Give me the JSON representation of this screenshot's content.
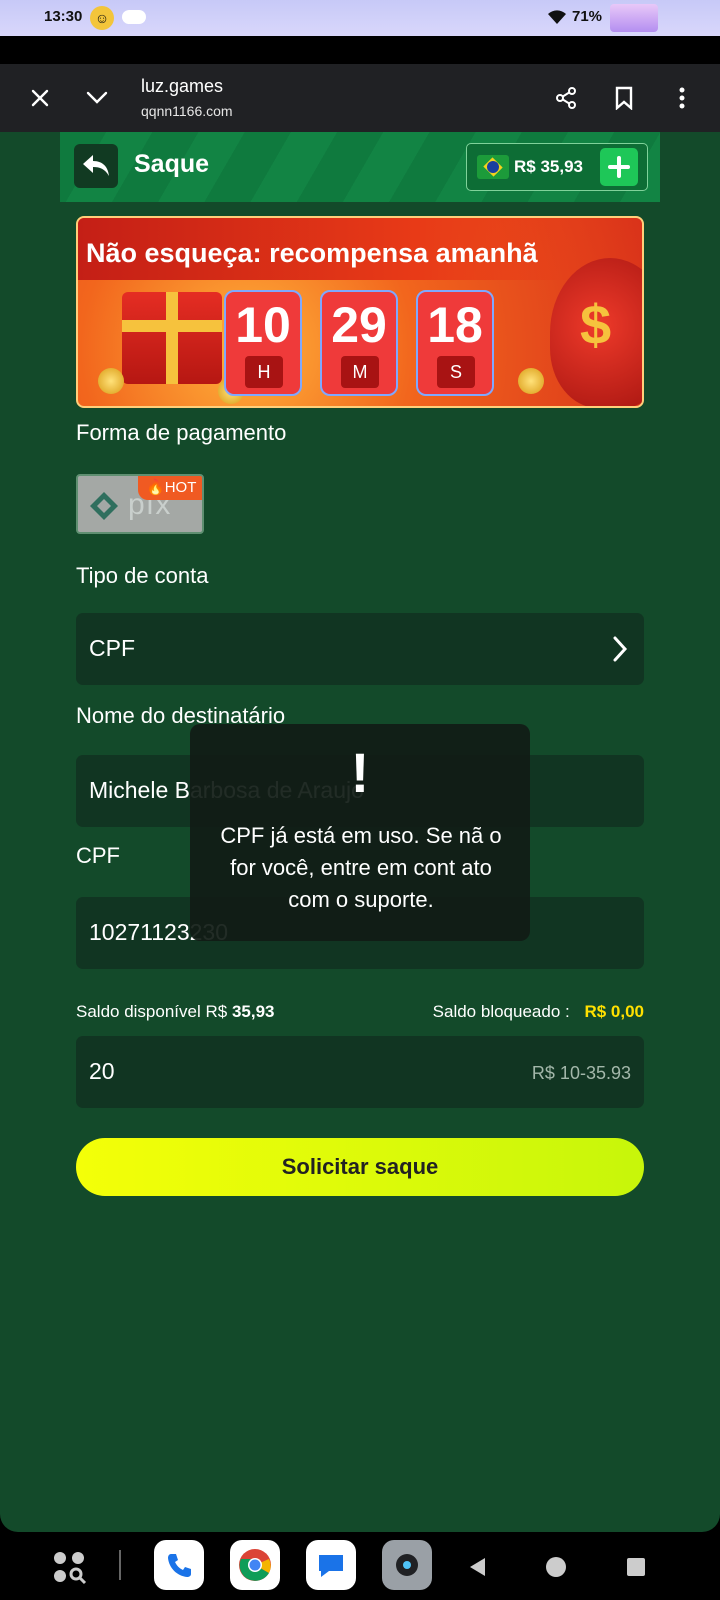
{
  "status_bar": {
    "time": "13:30",
    "battery": "71%"
  },
  "browser": {
    "site": "luz.games",
    "url": "qqnn1166.com"
  },
  "header": {
    "title": "Saque",
    "balance": "R$ 35,93"
  },
  "banner": {
    "headline": "Não esqueça: recompensa amanhã",
    "timer": [
      {
        "value": "10",
        "unit": "H"
      },
      {
        "value": "29",
        "unit": "M"
      },
      {
        "value": "18",
        "unit": "S"
      }
    ]
  },
  "payment": {
    "label": "Forma de pagamento",
    "method": "pix",
    "badge": "HOT"
  },
  "account_type": {
    "label": "Tipo de conta",
    "value": "CPF"
  },
  "recipient": {
    "label": "Nome do destinatário",
    "value": "Michele Barbosa de Araujo"
  },
  "cpf": {
    "label": "CPF",
    "value": "10271123230"
  },
  "saldo": {
    "available_label": "Saldo disponível R$",
    "available_value": "35,93",
    "blocked_label": "Saldo bloqueado :",
    "blocked_value": "R$ 0,00"
  },
  "amount": {
    "value": "20",
    "range_hint": "R$ 10-35.93"
  },
  "submit_label": "Solicitar saque",
  "toast": {
    "mark": "!",
    "message": "CPF já está em uso. Se nã o for você, entre em cont ato com o suporte."
  },
  "colors": {
    "page_bg": "#134a2a",
    "accent_green": "#1ec758",
    "button_yellow": "#f4ff08",
    "blocked_yellow": "#ffe000"
  }
}
